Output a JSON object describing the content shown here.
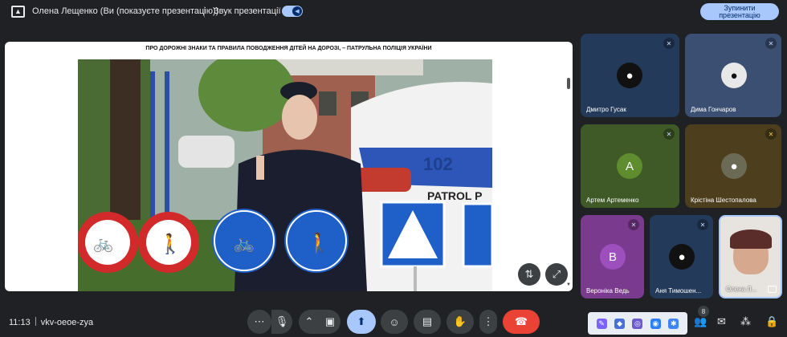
{
  "banner": {
    "presenter": "Олена Лещенко (Ви (показуєте презентацію))",
    "sound_label": "Звук презентації",
    "stop_button": "Зупинити презентацію"
  },
  "presentation": {
    "title": "ПРО ДОРОЖНІ ЗНАКИ ТА ПРАВИЛА ПОВОДЖЕННЯ ДІТЕЙ НА ДОРОЗІ, – ПАТРУЛЬНА ПОЛІЦІЯ УКРАЇНИ",
    "car_phone": "102",
    "car_text": "PATROL P"
  },
  "participants": [
    {
      "name": "Дмитро Гусак",
      "muted": true,
      "avatar": "photo"
    },
    {
      "name": "Дима Гончаров",
      "muted": true,
      "avatar": "photo"
    },
    {
      "name": "Артем Артеменко",
      "muted": true,
      "avatar": "А"
    },
    {
      "name": "Крістіна Шестопалова",
      "muted": true,
      "avatar": "photo"
    },
    {
      "name": "Вероніка Ведь",
      "muted": true,
      "avatar": "В"
    },
    {
      "name": "Аня Тимошен...",
      "muted": true,
      "avatar": "photo"
    },
    {
      "name": "Олена Л...",
      "muted": false,
      "avatar": "camera"
    }
  ],
  "meeting": {
    "time": "11:13",
    "code": "vkv-oeoe-zya",
    "participant_count": "8"
  },
  "colors": {
    "accent": "#a8c7fa",
    "end_call": "#ea4335",
    "background": "#202124"
  }
}
